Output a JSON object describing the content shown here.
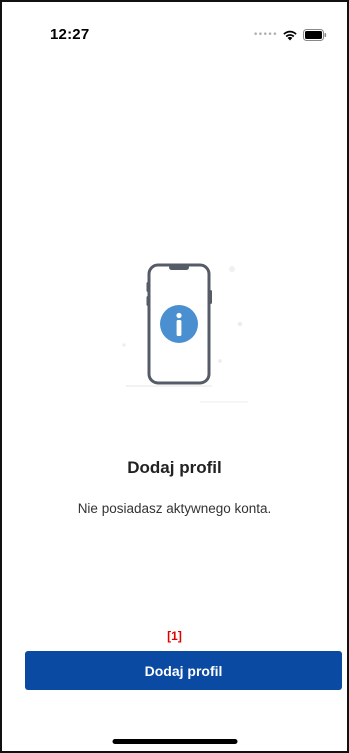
{
  "status_bar": {
    "time": "12:27",
    "signal_icon": "signal-dots-icon",
    "wifi_icon": "wifi-icon",
    "battery_icon": "battery-icon"
  },
  "empty_state": {
    "illustration_icon": "phone-info-icon",
    "title": "Dodaj profil",
    "subtitle": "Nie posiadasz aktywnego konta."
  },
  "annotation": {
    "marker": "[1]"
  },
  "footer": {
    "add_profile_label": "Dodaj profil"
  },
  "colors": {
    "primary": "#0b4aa2",
    "info_circle": "#4a8fd0",
    "phone_outline": "#555b67",
    "annotation": "#e00000"
  }
}
